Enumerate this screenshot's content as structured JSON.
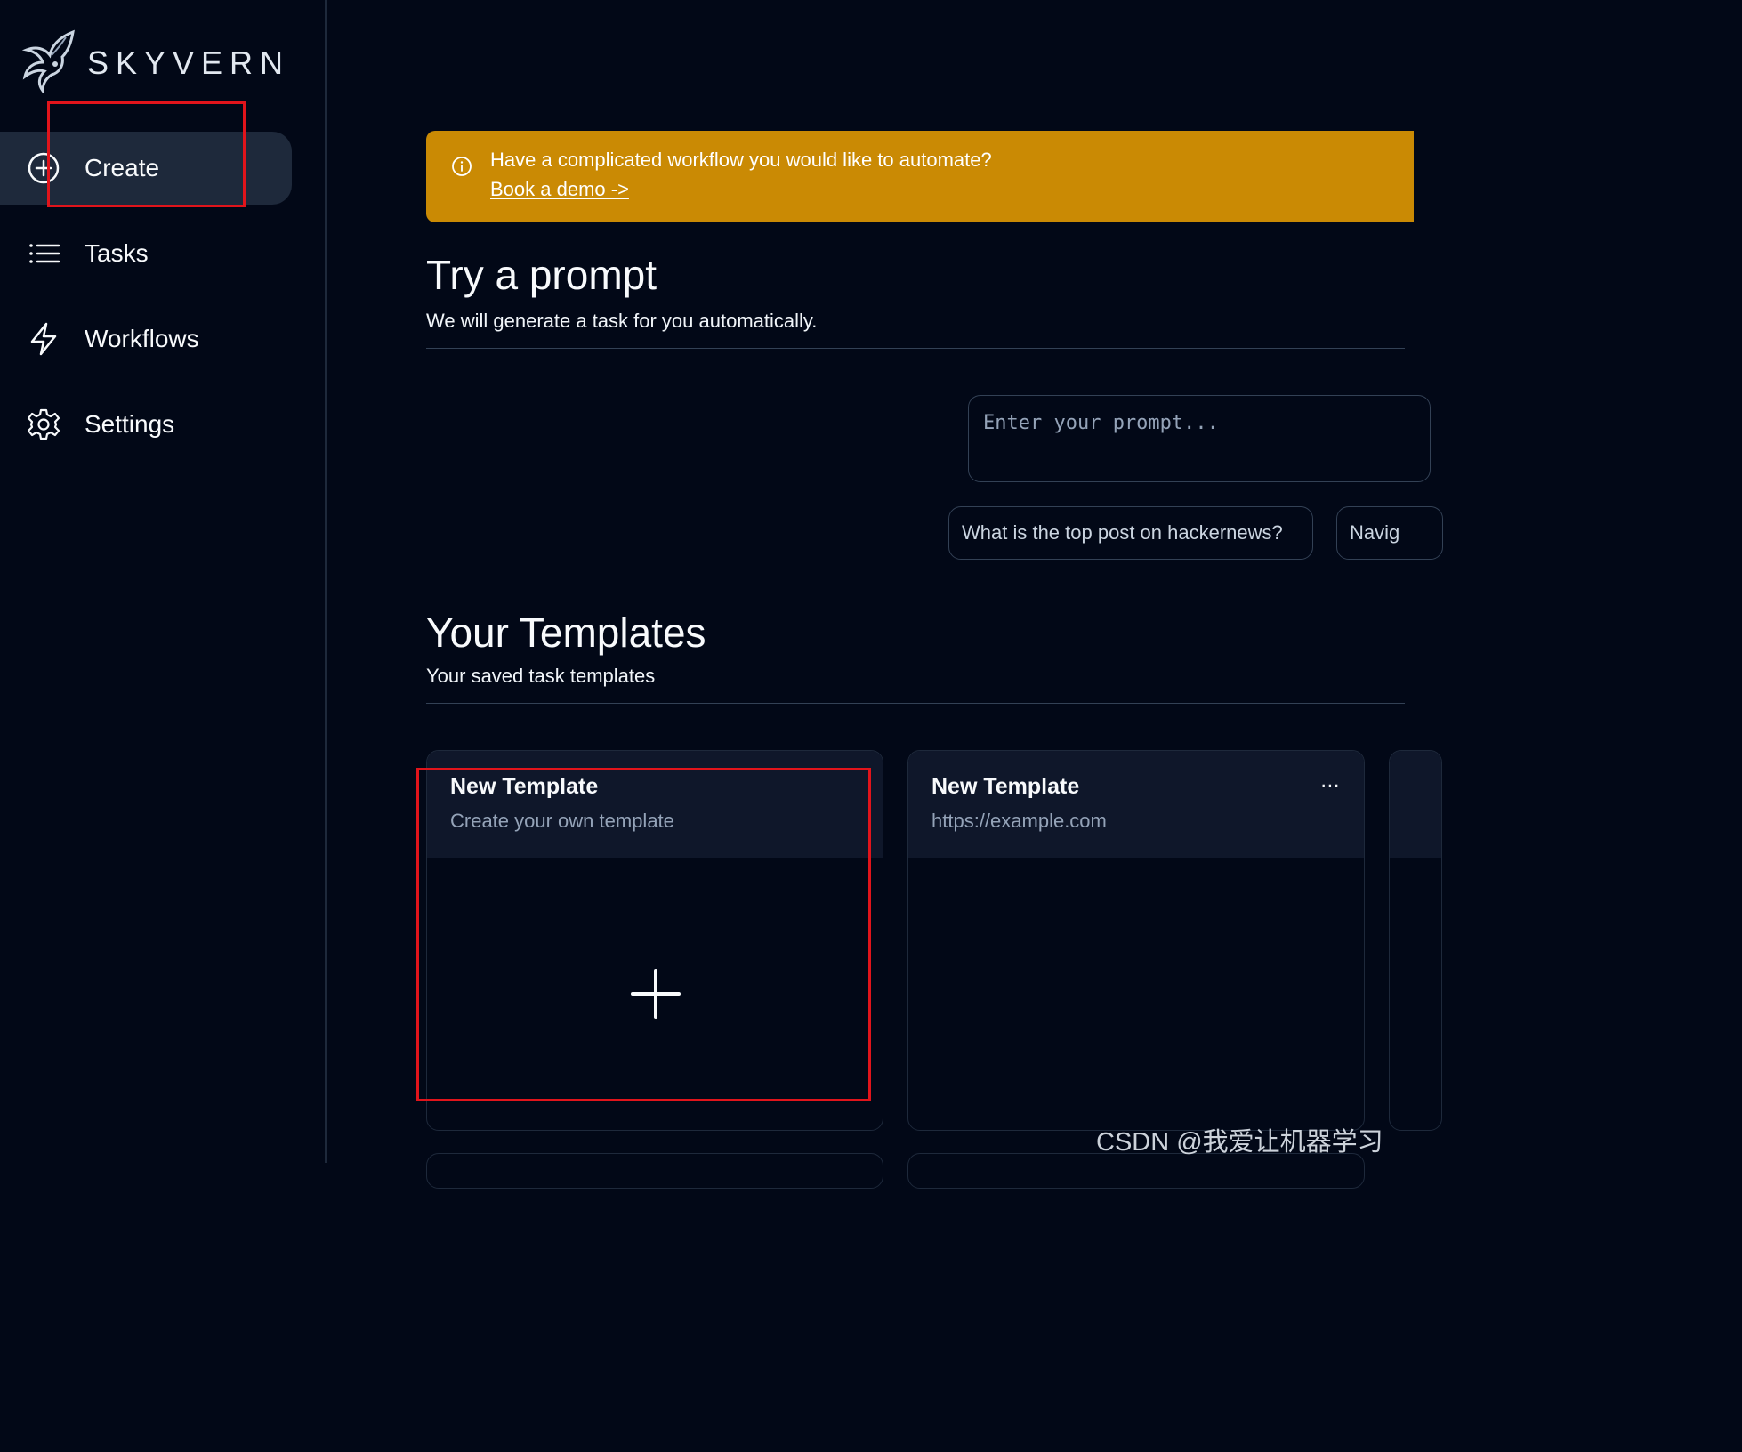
{
  "app": {
    "name": "SKYVERN"
  },
  "sidebar": {
    "items": [
      {
        "label": "Create",
        "icon": "plus-circle-icon",
        "active": true
      },
      {
        "label": "Tasks",
        "icon": "list-icon",
        "active": false
      },
      {
        "label": "Workflows",
        "icon": "lightning-icon",
        "active": false
      },
      {
        "label": "Settings",
        "icon": "gear-icon",
        "active": false
      }
    ]
  },
  "banner": {
    "text": "Have a complicated workflow you would like to automate?",
    "link": "Book a demo ->",
    "color": "#ca8a04"
  },
  "prompt": {
    "title": "Try a prompt",
    "subtitle": "We will generate a task for you automatically.",
    "placeholder": "Enter your prompt...",
    "suggestions": [
      "What is the top post on hackernews?",
      "Navig"
    ]
  },
  "templates": {
    "title": "Your Templates",
    "subtitle": "Your saved task templates",
    "cards": [
      {
        "title": "New Template",
        "description": "Create your own template"
      },
      {
        "title": "New Template",
        "description": "https://example.com"
      }
    ]
  },
  "watermark": "CSDN @我爱让机器学习",
  "colors": {
    "background": "#020817",
    "sidebar_active": "#1e293b",
    "annotation": "#e1141b"
  }
}
